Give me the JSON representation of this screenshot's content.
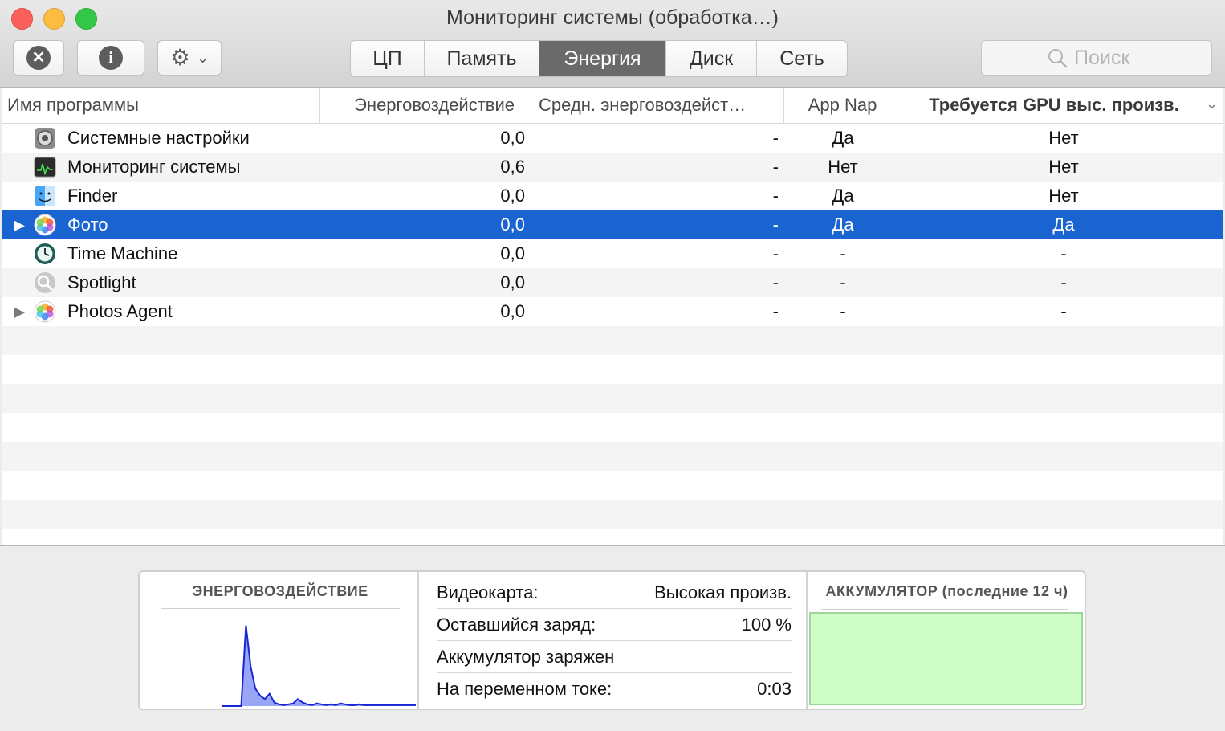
{
  "window": {
    "title": "Мониторинг системы (обработка…)"
  },
  "toolbar": {
    "stop_icon": "x-circle-icon",
    "info_icon": "info-circle-icon",
    "gear_icon": "gear-icon",
    "tabs": [
      {
        "label": "ЦП",
        "active": false
      },
      {
        "label": "Память",
        "active": false
      },
      {
        "label": "Энергия",
        "active": true
      },
      {
        "label": "Диск",
        "active": false
      },
      {
        "label": "Сеть",
        "active": false
      }
    ],
    "search_placeholder": "Поиск"
  },
  "table": {
    "columns": [
      "Имя программы",
      "Энерговоздействие",
      "Средн. энерговоздейст…",
      "App Nap",
      "Требуется GPU выс. произв."
    ],
    "rows": [
      {
        "disclosure": "",
        "icon": "system-preferences-icon",
        "name": "Системные настройки",
        "energy": "0,0",
        "avg": "-",
        "app_nap": "Да",
        "gpu": "Нет",
        "selected": false
      },
      {
        "disclosure": "",
        "icon": "activity-monitor-icon",
        "name": "Мониторинг системы",
        "energy": "0,6",
        "avg": "-",
        "app_nap": "Нет",
        "gpu": "Нет",
        "selected": false
      },
      {
        "disclosure": "",
        "icon": "finder-icon",
        "name": "Finder",
        "energy": "0,0",
        "avg": "-",
        "app_nap": "Да",
        "gpu": "Нет",
        "selected": false
      },
      {
        "disclosure": "▶",
        "icon": "photos-icon",
        "name": "Фото",
        "energy": "0,0",
        "avg": "-",
        "app_nap": "Да",
        "gpu": "Да",
        "selected": true
      },
      {
        "disclosure": "",
        "icon": "time-machine-icon",
        "name": "Time Machine",
        "energy": "0,0",
        "avg": "-",
        "app_nap": "-",
        "gpu": "-",
        "selected": false
      },
      {
        "disclosure": "",
        "icon": "spotlight-icon",
        "name": "Spotlight",
        "energy": "0,0",
        "avg": "-",
        "app_nap": "-",
        "gpu": "-",
        "selected": false
      },
      {
        "disclosure": "▶",
        "icon": "photos-icon",
        "name": "Photos Agent",
        "energy": "0,0",
        "avg": "-",
        "app_nap": "-",
        "gpu": "-",
        "selected": false
      }
    ]
  },
  "bottom": {
    "energy_title": "ЭНЕРГОВОЗДЕЙСТВИЕ",
    "info": [
      {
        "label": "Видеокарта:",
        "value": "Высокая произв."
      },
      {
        "label": "Оставшийся заряд:",
        "value": "100 %"
      },
      {
        "label": "Аккумулятор заряжен",
        "value": ""
      },
      {
        "label": "На переменном токе:",
        "value": "0:03"
      }
    ],
    "battery_title": "АККУМУЛЯТОР (последние 12 ч)"
  },
  "chart_data": {
    "type": "area",
    "title": "ЭНЕРГОВОЗДЕЙСТВИЕ",
    "values": [
      0,
      0,
      0,
      0,
      0,
      92,
      45,
      20,
      12,
      8,
      14,
      4,
      2,
      1,
      2,
      3,
      8,
      4,
      2,
      1,
      3,
      2,
      1,
      2,
      1,
      3,
      2,
      1,
      1,
      2,
      1,
      1,
      1,
      1,
      1,
      1,
      1,
      1,
      1,
      1,
      1,
      1
    ],
    "ylim": [
      0,
      100
    ],
    "colors": {
      "fill": "#9aa6f5",
      "stroke": "#1726d6"
    }
  }
}
